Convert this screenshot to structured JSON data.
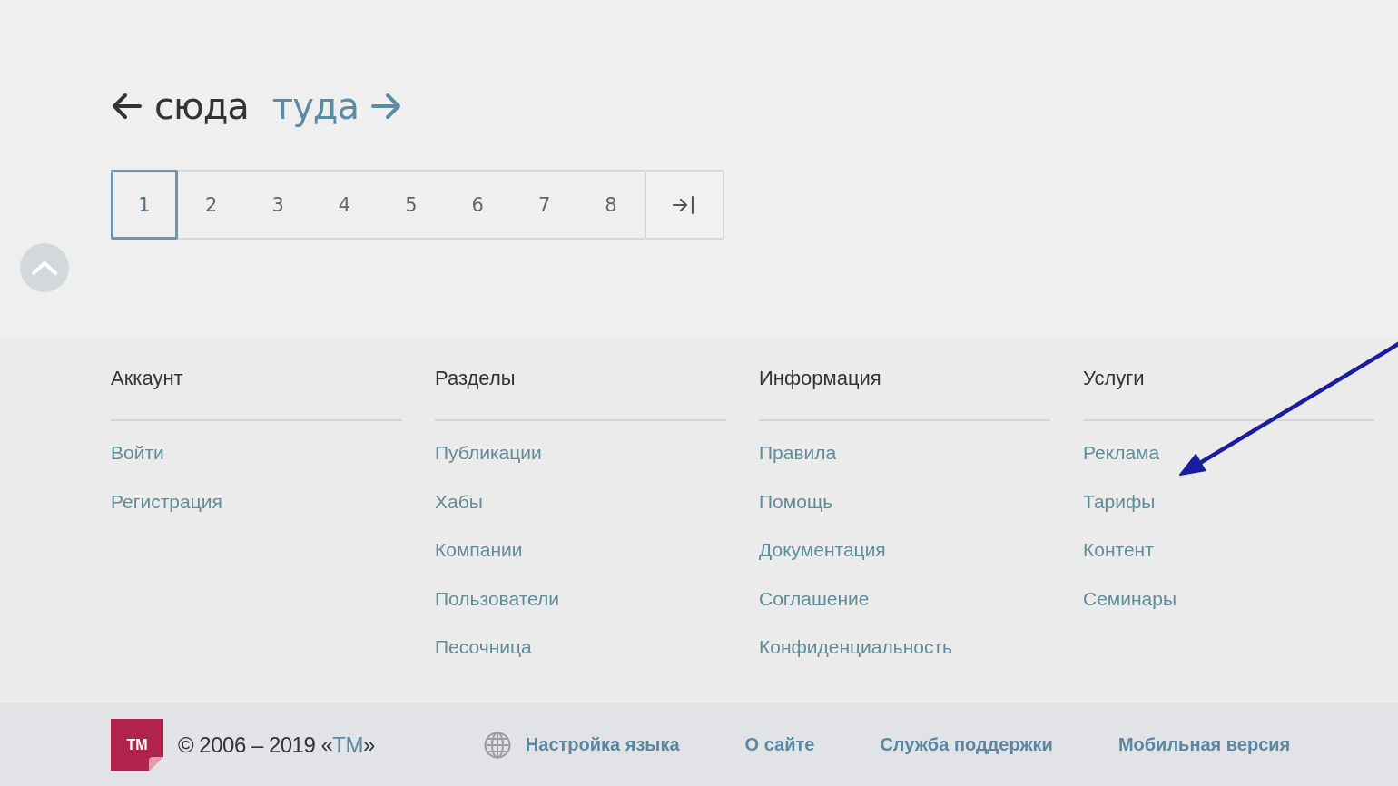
{
  "pager_nav": {
    "prev": {
      "label": "сюда",
      "disabled": true
    },
    "next": {
      "label": "туда",
      "disabled": false
    }
  },
  "pagination": {
    "pages": [
      {
        "label": "1",
        "selected": true
      },
      {
        "label": "2",
        "selected": false
      },
      {
        "label": "3",
        "selected": false
      },
      {
        "label": "4",
        "selected": false
      },
      {
        "label": "5",
        "selected": false
      },
      {
        "label": "6",
        "selected": false
      },
      {
        "label": "7",
        "selected": false
      },
      {
        "label": "8",
        "selected": false
      }
    ]
  },
  "footer_columns": [
    {
      "title": "Аккаунт",
      "links": [
        "Войти",
        "Регистрация"
      ]
    },
    {
      "title": "Разделы",
      "links": [
        "Публикации",
        "Хабы",
        "Компании",
        "Пользователи",
        "Песочница"
      ]
    },
    {
      "title": "Информация",
      "links": [
        "Правила",
        "Помощь",
        "Документация",
        "Соглашение",
        "Конфиденциальность"
      ]
    },
    {
      "title": "Услуги",
      "links": [
        "Реклама",
        "Тарифы",
        "Контент",
        "Семинары"
      ]
    }
  ],
  "bottom_bar": {
    "logo": "ТМ",
    "copyright": {
      "text": "© 2006 – 2019 «",
      "link": "ТМ",
      "suffix": "»"
    },
    "links": [
      {
        "label": "Настройка языка",
        "kind": "language"
      },
      {
        "label": "О сайте",
        "kind": "link"
      },
      {
        "label": "Служба поддержки",
        "kind": "link"
      },
      {
        "label": "Мобильная версия",
        "kind": "link"
      }
    ]
  }
}
